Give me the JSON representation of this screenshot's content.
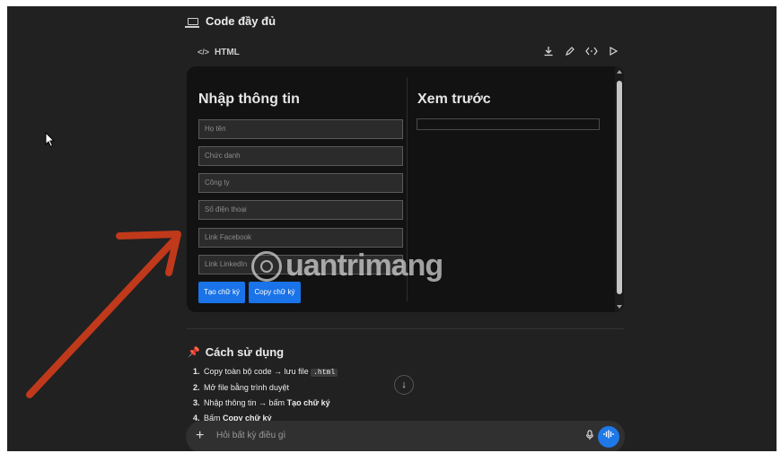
{
  "header": {
    "title": "Code đầy đủ",
    "icon": "laptop-icon"
  },
  "code_bar": {
    "lang": "HTML",
    "tools": [
      "download-icon",
      "edit-icon",
      "code-icon",
      "play-icon"
    ]
  },
  "form": {
    "heading": "Nhập thông tin",
    "fields": [
      "Họ tên",
      "Chức danh",
      "Công ty",
      "Số điện thoại",
      "Link Facebook",
      "Link LinkedIn"
    ],
    "create_button": "Tạo chữ ký",
    "copy_button": "Copy chữ ký"
  },
  "preview": {
    "heading": "Xem trước"
  },
  "usage": {
    "title": "Cách sử dụng",
    "step1_pre": "Copy toàn bộ code → lưu file",
    "step1_code": ".html",
    "step2": "Mở file bằng trình duyệt",
    "step3_pre": "Nhập thông tin → bấm",
    "step3_bold": "Tạo chữ ký",
    "step4_pre": "Bấm",
    "step4_bold": "Copy chữ ký"
  },
  "composer": {
    "placeholder": "Hỏi bất kỳ điều gì"
  },
  "watermark": "uantrimang",
  "colors": {
    "accent": "#1a73e8",
    "annotation_arrow": "#c0391b",
    "background": "#212121"
  }
}
